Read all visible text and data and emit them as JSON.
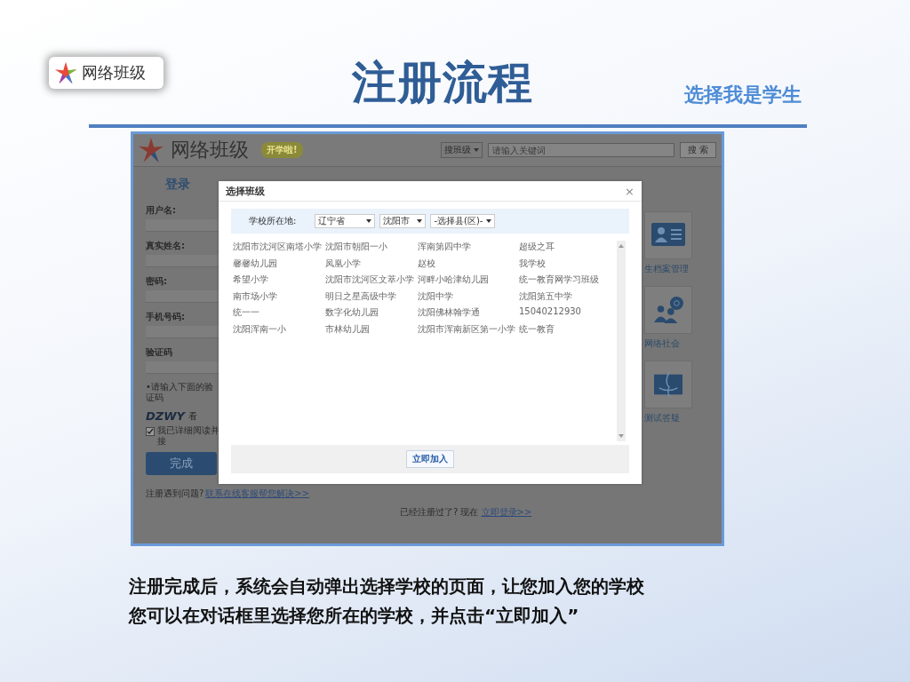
{
  "slide": {
    "logo_text": "网络班级",
    "title": "注册流程",
    "subtitle": "选择我是学生",
    "caption": [
      "注册完成后，系统会自动弹出选择学校的页面，让您加入您的学校",
      "您可以在对话框里选择您所在的学校，并点击“立即加入”"
    ]
  },
  "site": {
    "logo_text": "网络班级",
    "badge": "开学啦!",
    "search_scope": "搜班级",
    "search_placeholder": "请输入关键词",
    "search_button": "搜 索",
    "login_tab": "登录",
    "form_labels": [
      "用户名:",
      "真实姓名:",
      "密码:",
      "手机号码:",
      "验证码"
    ],
    "captcha_hint": "•请输入下面的验证码",
    "captcha_text": "DZWY",
    "captcha_side": "看",
    "agree": {
      "label": "我已详细阅读并接",
      "checked": true
    },
    "submit": "完成",
    "help_text": "注册遇到问题?",
    "help_link": "联系在线客服帮您解决>>",
    "login_prompt": "已经注册过了? 现在",
    "login_link": "立即登录>>",
    "features": [
      {
        "kind": "card",
        "label": "生档案管理"
      },
      {
        "kind": "people",
        "label": "网络社会"
      },
      {
        "kind": "face",
        "label": "测试答疑"
      }
    ]
  },
  "dialog": {
    "title": "选择班级",
    "close": "×",
    "location_label": "学校所在地:",
    "selects": [
      "辽宁省",
      "沈阳市",
      "-选择县(区)-"
    ],
    "schools": [
      [
        "沈阳市沈河区南塔小学",
        "沈阳市朝阳一小",
        "浑南第四中学",
        "超级之耳"
      ],
      [
        "馨馨幼儿园",
        "凤凰小学",
        "赵校",
        "我学校"
      ],
      [
        "希望小学",
        "沈阳市沈河区文萃小学",
        "河畔小哈津幼儿园",
        "统一教育网学习班级"
      ],
      [
        "南市场小学",
        "明日之星高级中学",
        "沈阳中学",
        "沈阳第五中学"
      ],
      [
        "统一一",
        "数字化幼儿园",
        "沈阳佛林翰学通",
        "15040212930"
      ],
      [
        "沈阳浑南一小",
        "市林幼儿园",
        "沈阳市浑南新区第一小学",
        "统一教育"
      ]
    ],
    "button": "立即加入"
  }
}
